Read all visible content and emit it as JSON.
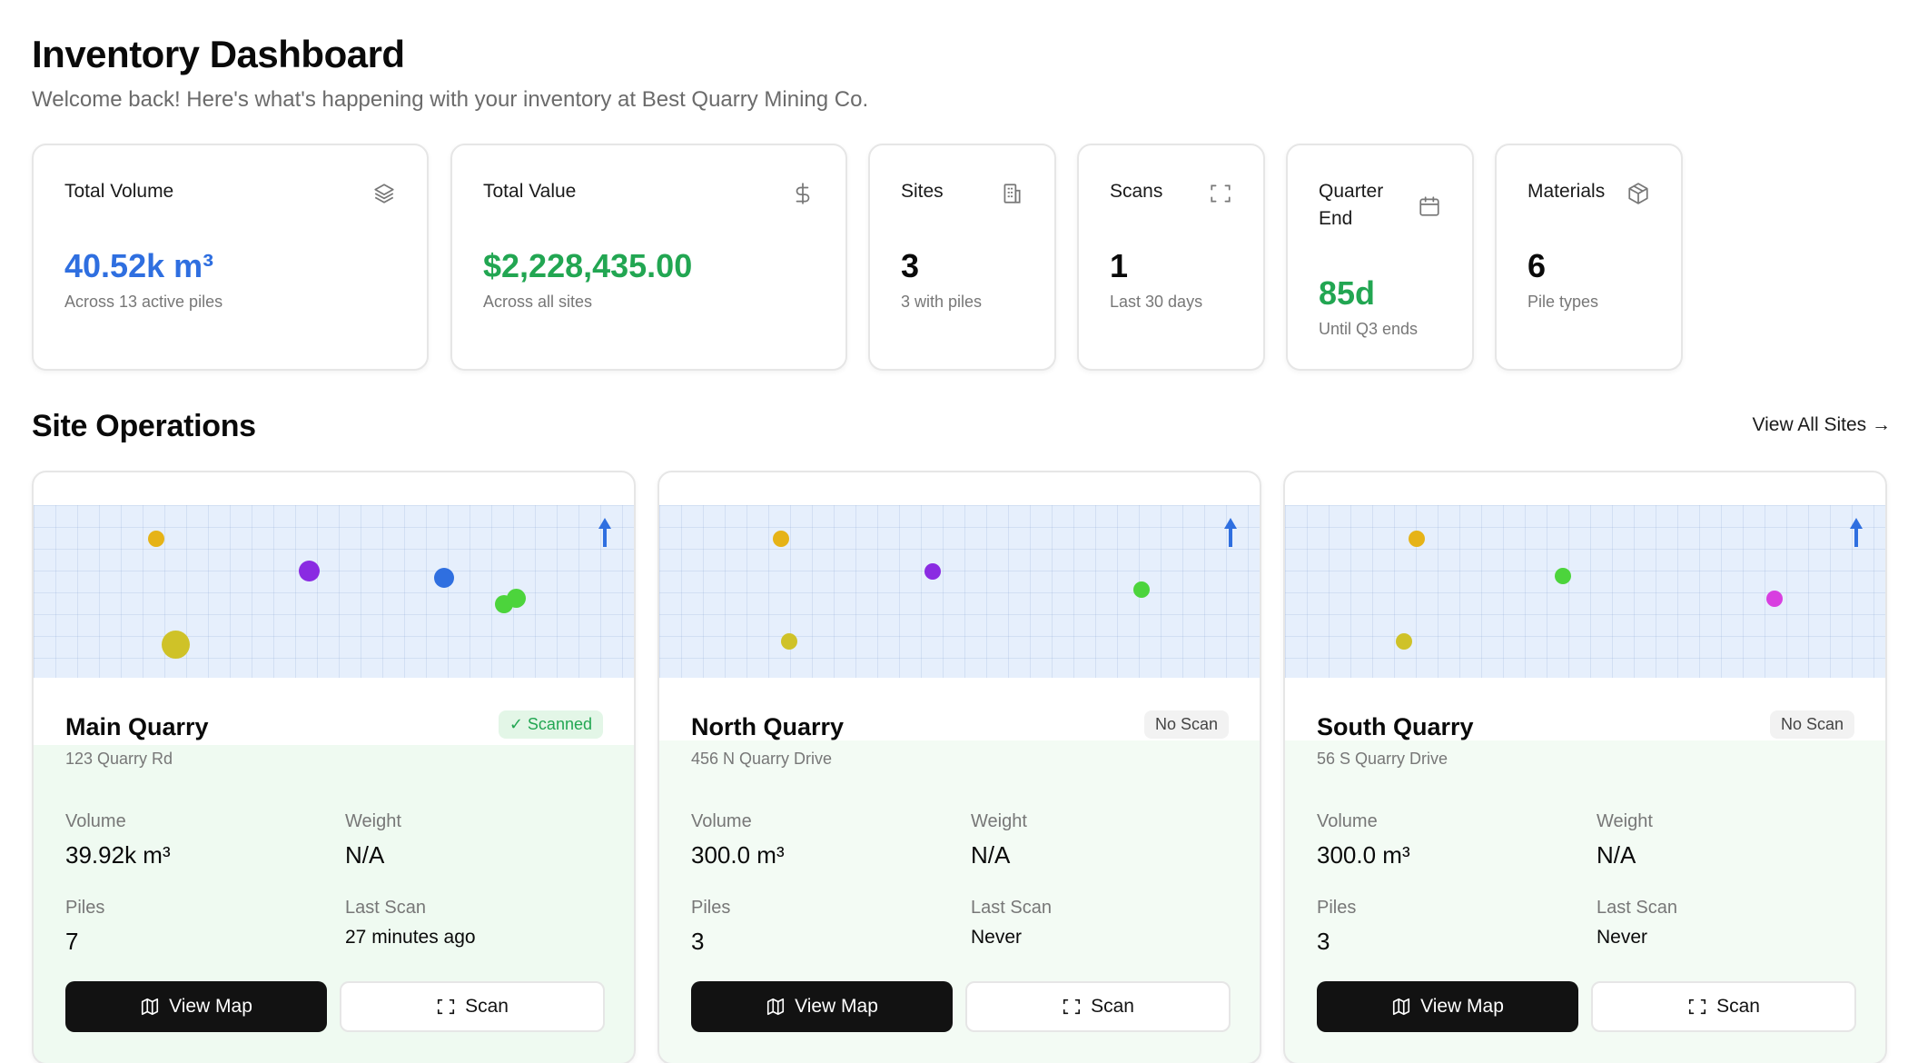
{
  "header": {
    "title": "Inventory Dashboard",
    "subtitle": "Welcome back! Here's what's happening with your inventory at Best Quarry Mining Co."
  },
  "stats": [
    {
      "label": "Total Volume",
      "value": "40.52k m³",
      "sub": "Across 13 active piles",
      "icon": "layers-icon",
      "color": "#2f6fe0"
    },
    {
      "label": "Total Value",
      "value": "$2,228,435.00",
      "sub": "Across all sites",
      "icon": "dollar-icon",
      "color": "#22a652"
    },
    {
      "label": "Sites",
      "value": "3",
      "sub": "3 with piles",
      "icon": "building-icon",
      "color": "#0a0a0a"
    },
    {
      "label": "Scans",
      "value": "1",
      "sub": "Last 30 days",
      "icon": "scan-icon",
      "color": "#0a0a0a"
    },
    {
      "label": "Quarter End",
      "value": "85d",
      "sub": "Until Q3 ends",
      "icon": "calendar-icon",
      "color": "#22a652"
    },
    {
      "label": "Materials",
      "value": "6",
      "sub": "Pile types",
      "icon": "box-icon",
      "color": "#0a0a0a"
    }
  ],
  "section": {
    "title": "Site Operations",
    "view_all": "View All Sites →"
  },
  "labels": {
    "volume": "Volume",
    "weight": "Weight",
    "piles": "Piles",
    "last_scan": "Last Scan",
    "view_map": "View Map",
    "scan": "Scan"
  },
  "sites": [
    {
      "name": "Main Quarry",
      "address": "123 Quarry Rd",
      "badge": "✓ Scanned",
      "volume": "39.92k m³",
      "weight": "N/A",
      "piles": "7",
      "last_scan": "27 minutes ago",
      "pins": [
        {
          "color": "#e6b317"
        },
        {
          "color": "#8a2be2"
        },
        {
          "color": "#2f6fe0"
        },
        {
          "color": "#4cd43c"
        },
        {
          "color": "#4cd43c"
        },
        {
          "color": "#cfc228"
        }
      ]
    },
    {
      "name": "North Quarry",
      "address": "456 N Quarry Drive",
      "badge": "No Scan",
      "volume": "300.0 m³",
      "weight": "N/A",
      "piles": "3",
      "last_scan": "Never",
      "pins": [
        {
          "color": "#e6b317"
        },
        {
          "color": "#8a2be2"
        },
        {
          "color": "#4cd43c"
        },
        {
          "color": "#cfc228"
        }
      ]
    },
    {
      "name": "South Quarry",
      "address": "56 S Quarry Drive",
      "badge": "No Scan",
      "volume": "300.0 m³",
      "weight": "N/A",
      "piles": "3",
      "last_scan": "Never",
      "pins": [
        {
          "color": "#e6b317"
        },
        {
          "color": "#4cd43c"
        },
        {
          "color": "#d83fe0"
        },
        {
          "color": "#cfc228"
        }
      ]
    }
  ]
}
